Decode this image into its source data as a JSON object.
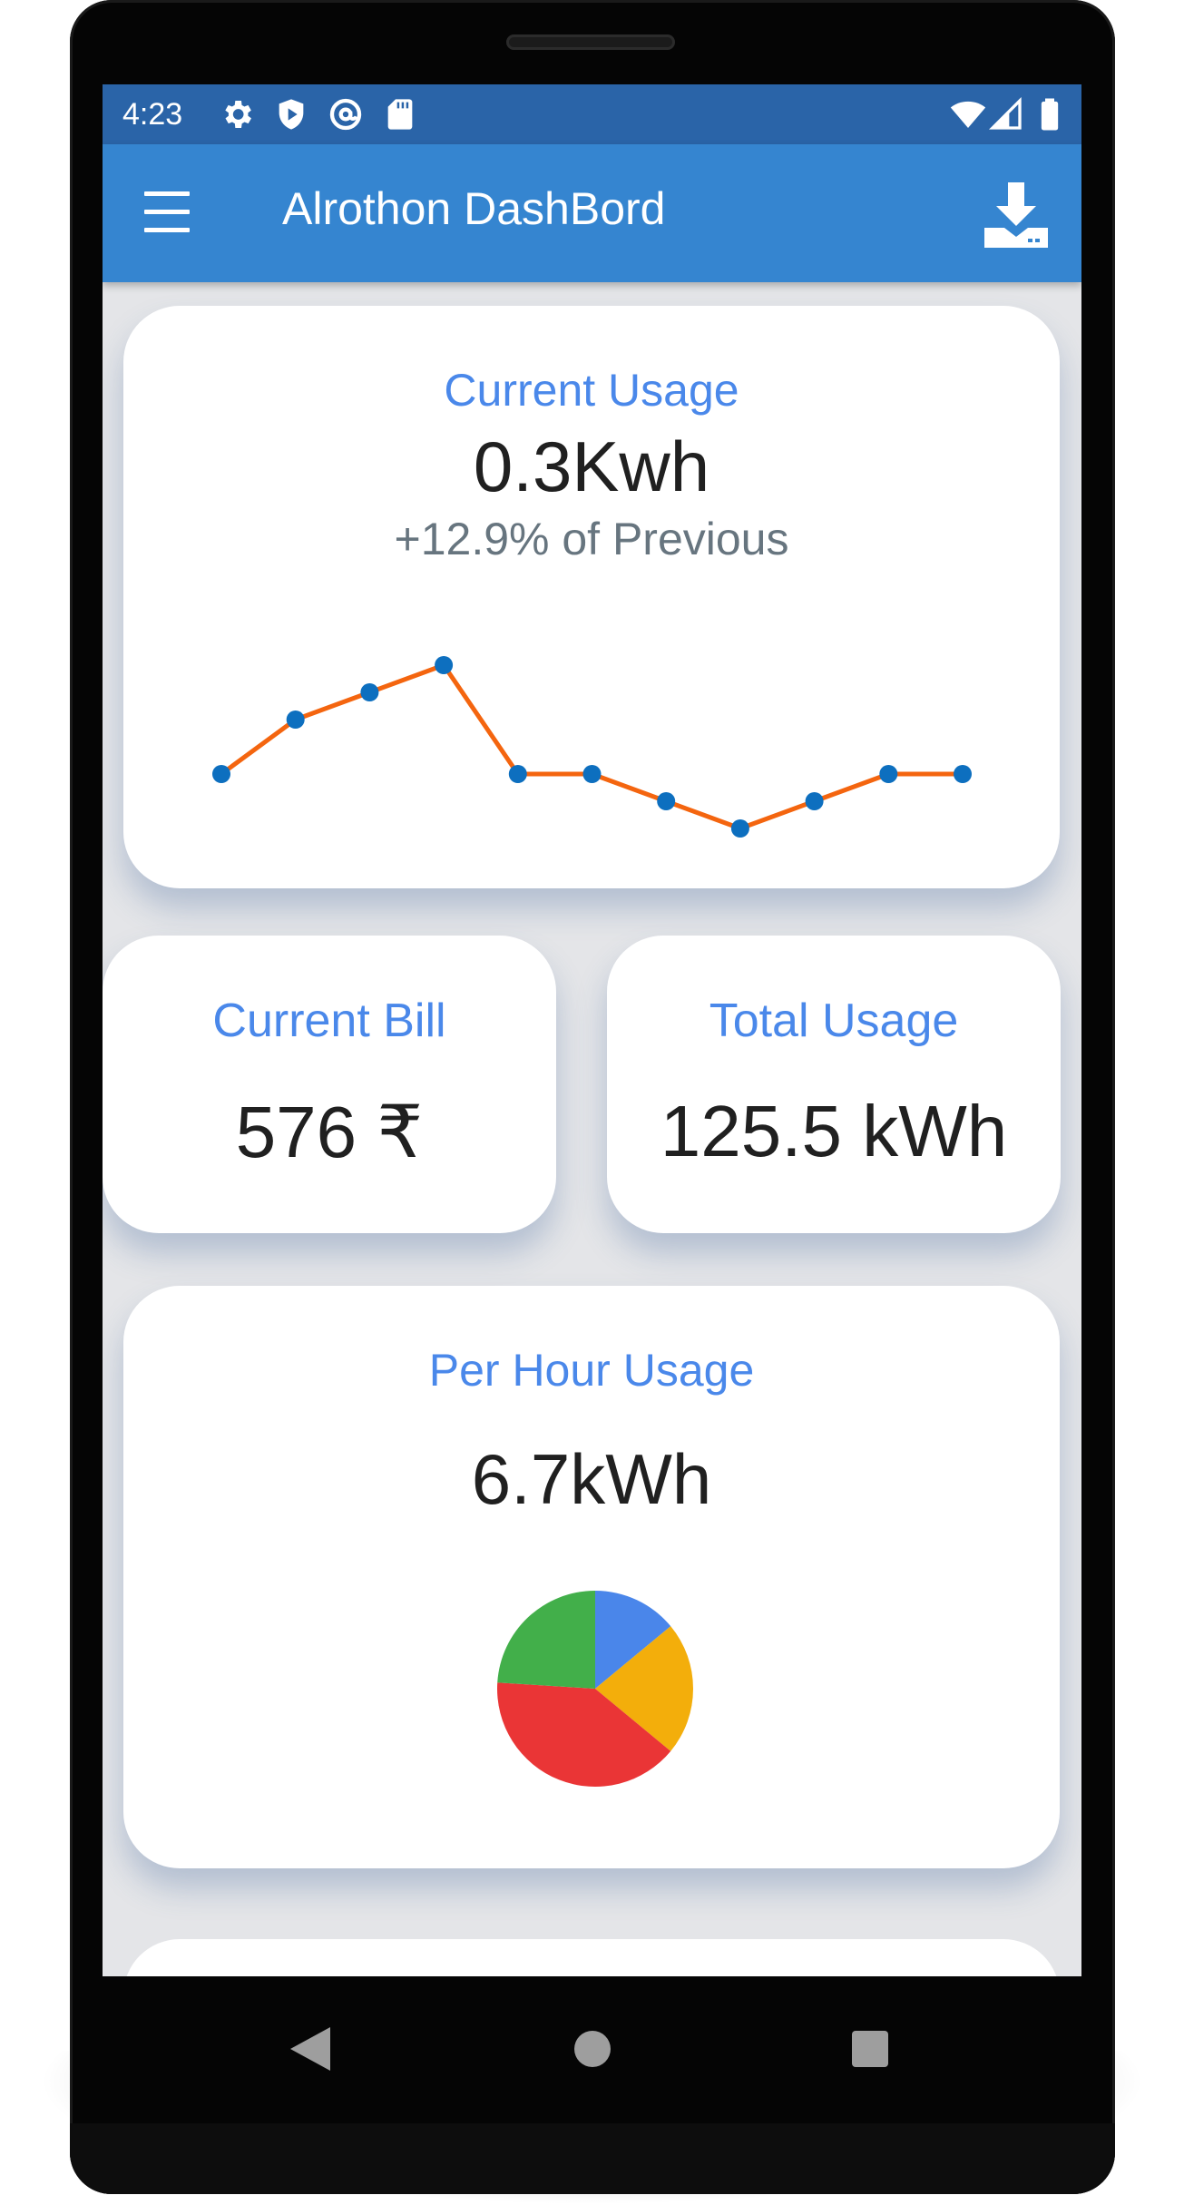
{
  "status_bar": {
    "time": "4:23",
    "left_icons": [
      "gear-icon",
      "shield-play-icon",
      "at-sign-icon",
      "sd-card-icon"
    ],
    "right_icons": [
      "wifi-icon",
      "signal-icon",
      "battery-icon"
    ]
  },
  "app_bar": {
    "title": "Alrothon DashBord",
    "menu_icon": "hamburger-menu-icon",
    "action_icon": "download-icon"
  },
  "current_usage": {
    "title": "Current Usage",
    "value": "0.3Kwh",
    "change": "+12.9% of Previous"
  },
  "current_bill": {
    "title": "Current Bill",
    "value": "576 ₹"
  },
  "total_usage": {
    "title": "Total Usage",
    "value": "125.5 kWh"
  },
  "per_hour_usage": {
    "title": "Per Hour Usage",
    "value": "6.7kWh"
  },
  "nav_bar": {
    "icons": [
      "back-triangle-icon",
      "home-circle-icon",
      "recents-square-icon"
    ]
  },
  "colors": {
    "status_bar": "#2a64a8",
    "app_bar": "#3585d0",
    "card_title": "#4a88ea",
    "line": "#f4650f",
    "line_points": "#0d6fbf"
  },
  "chart_data": [
    {
      "type": "line",
      "x": [
        0,
        1,
        2,
        3,
        4,
        5,
        6,
        7,
        8,
        9,
        10
      ],
      "values": [
        0.2,
        0.3,
        0.35,
        0.4,
        0.2,
        0.2,
        0.15,
        0.1,
        0.15,
        0.2,
        0.2
      ],
      "ylim": [
        0.1,
        0.4
      ],
      "grid": false,
      "axes_visible": false,
      "line_color": "#f4650f",
      "point_color": "#0d6fbf"
    },
    {
      "type": "pie",
      "values": [
        14,
        22,
        40,
        24
      ],
      "colors": [
        "#4a86ea",
        "#f3ae0b",
        "#ea3536",
        "#42af4a"
      ],
      "start": "top",
      "direction": "clockwise"
    }
  ]
}
